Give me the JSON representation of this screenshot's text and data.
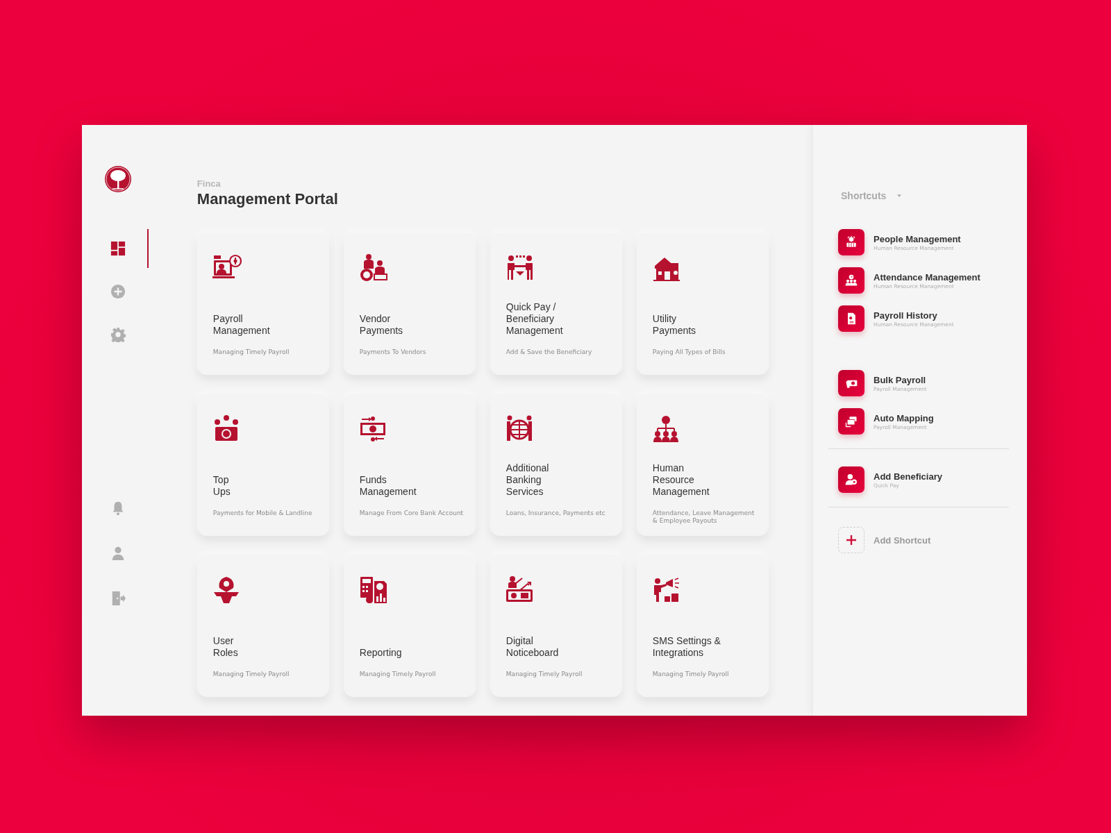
{
  "sidebar": {
    "nav_top": [
      {
        "kind": "dashboard",
        "selected": true
      },
      {
        "kind": "add",
        "selected": false
      },
      {
        "kind": "settings",
        "selected": false
      }
    ],
    "nav_bottom": [
      {
        "kind": "notifications",
        "selected": false
      },
      {
        "kind": "profile",
        "selected": false
      },
      {
        "kind": "logout",
        "selected": false
      }
    ]
  },
  "header": {
    "brand": "Finca",
    "title": "Management Portal"
  },
  "modules": [
    {
      "title": "Payroll\nManagement",
      "description": "Managing Timely Payroll"
    },
    {
      "title": "Vendor\nPayments",
      "description": "Payments To Vendors"
    },
    {
      "title": "Quick Pay /\nBeneficiary\nManagement",
      "description": "Add & Save the Beneficiary"
    },
    {
      "title": "Utility\nPayments",
      "description": "Paying All Types of Bills"
    },
    {
      "title": "Top\nUps",
      "description": "Payments for Mobile & Landline"
    },
    {
      "title": "Funds\nManagement",
      "description": "Manage From Core Bank Account"
    },
    {
      "title": "Additional\nBanking\nServices",
      "description": "Loans, Insurance, Payments etc"
    },
    {
      "title": "Human\nResource\nManagement",
      "description": "Attendance, Leave Management & Employee Payouts"
    },
    {
      "title": "User\nRoles",
      "description": "Managing Timely Payroll"
    },
    {
      "title": "Reporting",
      "description": "Managing Timely Payroll"
    },
    {
      "title": "Digital\nNoticeboard",
      "description": "Managing Timely Payroll"
    },
    {
      "title": "SMS Settings &\nIntegrations",
      "description": "Managing Timely Payroll"
    }
  ],
  "shortcuts": {
    "title": "Shortcuts",
    "sections": [
      {
        "divider_before": false,
        "items": [
          {
            "title": "People Management",
            "subtitle": "Human Resource Management"
          },
          {
            "title": "Attendance Management",
            "subtitle": "Human Resource Management"
          },
          {
            "title": "Payroll History",
            "subtitle": "Human Resource Management"
          }
        ]
      },
      {
        "divider_before": false,
        "items": [
          {
            "title": "Bulk Payroll",
            "subtitle": "Payroll Management"
          },
          {
            "title": "Auto Mapping",
            "subtitle": "Payroll Management"
          }
        ]
      },
      {
        "divider_before": true,
        "items": [
          {
            "title": "Add Beneficiary",
            "subtitle": "Quick Pay"
          }
        ]
      }
    ],
    "add_label": "Add Shortcut"
  }
}
